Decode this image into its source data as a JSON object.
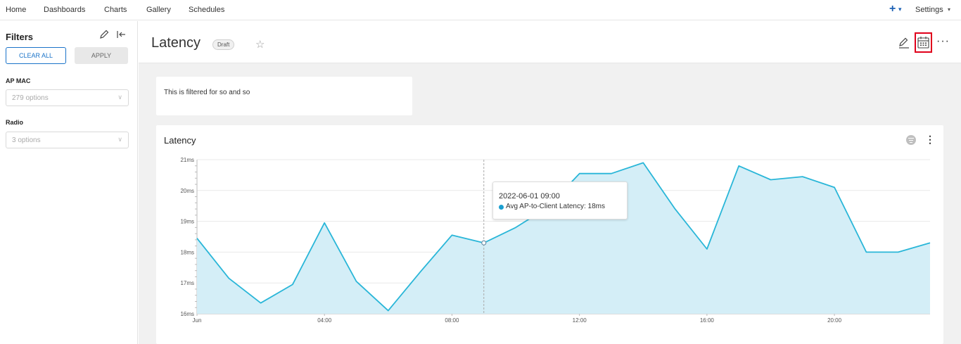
{
  "topnav": {
    "links": [
      "Home",
      "Dashboards",
      "Charts",
      "Gallery",
      "Schedules"
    ],
    "settings_label": "Settings"
  },
  "sidebar": {
    "title": "Filters",
    "clear_all_label": "CLEAR ALL",
    "apply_label": "APPLY",
    "filters": [
      {
        "label": "AP MAC",
        "placeholder": "279 options"
      },
      {
        "label": "Radio",
        "placeholder": "3 options"
      }
    ]
  },
  "header": {
    "title": "Latency",
    "badge": "Draft"
  },
  "text_card": {
    "text": "This is filtered for so and so"
  },
  "chart_card": {
    "title": "Latency",
    "tooltip": {
      "date": "2022-06-01 09:00",
      "series_label": "Avg AP-to-Client Latency: 18ms"
    }
  },
  "colors": {
    "accent": "#1a73c9",
    "line": "#29b6d8",
    "area": "#d4eef7",
    "highlight_box": "#e0001b"
  },
  "chart_data": {
    "type": "area",
    "x": [
      "00:00",
      "01:00",
      "02:00",
      "03:00",
      "04:00",
      "05:00",
      "06:00",
      "07:00",
      "08:00",
      "09:00",
      "10:00",
      "11:00",
      "12:00",
      "13:00",
      "14:00",
      "15:00",
      "16:00",
      "17:00",
      "18:00",
      "19:00",
      "20:00",
      "21:00",
      "22:00",
      "23:00"
    ],
    "series": [
      {
        "values": [
          18.45,
          17.15,
          16.35,
          16.95,
          18.95,
          17.05,
          16.1,
          17.35,
          18.55,
          18.3,
          18.8,
          19.45,
          20.55,
          20.55,
          20.9,
          19.4,
          18.1,
          20.8,
          20.35,
          20.45,
          20.1,
          18.0,
          18.0,
          18.3
        ]
      }
    ],
    "x_tick_labels": [
      "Jun",
      "04:00",
      "08:00",
      "12:00",
      "16:00",
      "20:00"
    ],
    "x_tick_indices": [
      0,
      4,
      8,
      12,
      16,
      20
    ],
    "y_tick_labels": [
      "16ms",
      "17ms",
      "18ms",
      "19ms",
      "20ms",
      "21ms"
    ],
    "ylim": [
      16,
      21
    ],
    "grid": true,
    "highlight_index": 9
  }
}
